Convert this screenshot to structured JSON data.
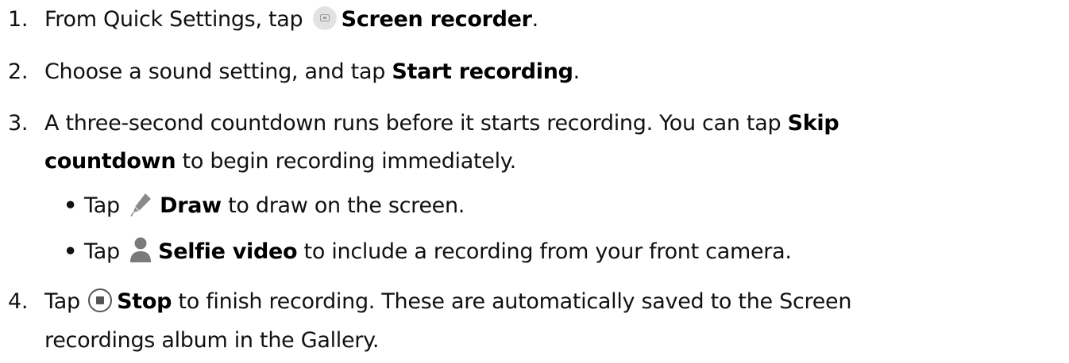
{
  "steps": [
    {
      "number": "1.",
      "before": "From Quick Settings, tap ",
      "icon": "screen-recorder-icon",
      "bold": "Screen recorder",
      "after": "."
    },
    {
      "number": "2.",
      "before": "Choose a sound setting, and tap ",
      "bold": "Start recording",
      "after": "."
    },
    {
      "number": "3.",
      "line1_before": "A three-second countdown runs before it starts recording. You can tap ",
      "line1_bold": "Skip",
      "line2_bold": "countdown",
      "line2_after": " to begin recording immediately.",
      "bullets": [
        {
          "marker": "•",
          "before": "Tap ",
          "icon": "pen-icon",
          "bold": "Draw",
          "after": " to draw on the screen."
        },
        {
          "marker": "•",
          "before": "Tap ",
          "icon": "person-icon",
          "bold": "Selfie video",
          "after": " to include a recording from your front camera."
        }
      ]
    },
    {
      "number": "4.",
      "before": "Tap ",
      "icon": "stop-icon",
      "bold": "Stop",
      "after": " to finish recording. These are automatically saved to the Screen",
      "line2": "recordings album in the Gallery."
    }
  ],
  "colors": {
    "text": "#111111",
    "icon_gray": "#9a9a9a",
    "pen_gray": "#8a8a8a",
    "person_gray": "#7a7a7a"
  }
}
